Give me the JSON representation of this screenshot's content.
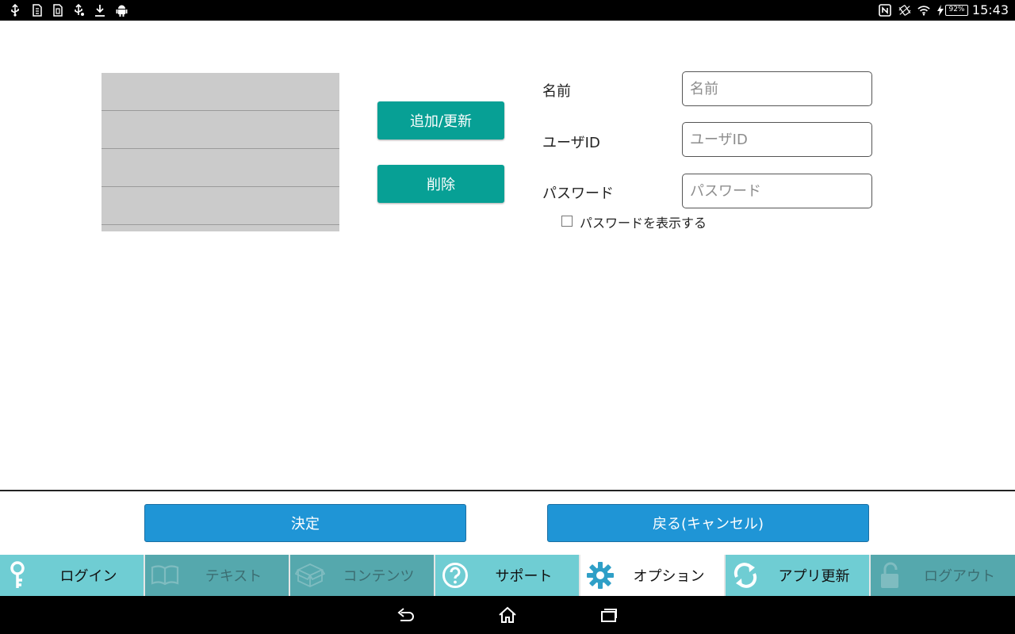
{
  "status_bar": {
    "time": "15:43",
    "battery": "92%",
    "left_icons": [
      "usb-icon",
      "sd-card-icon",
      "sd-card-icon",
      "usb-debug-icon",
      "download-icon",
      "android-icon"
    ],
    "right_icons": [
      "nfc-icon",
      "vibrate-icon",
      "wifi-icon",
      "charging-icon",
      "battery-icon"
    ]
  },
  "list": {
    "rows": 4
  },
  "buttons": {
    "add_update": "追加/更新",
    "delete": "削除",
    "ok": "決定",
    "back_cancel": "戻る(キャンセル)"
  },
  "form": {
    "name_label": "名前",
    "name_placeholder": "名前",
    "userid_label": "ユーザID",
    "userid_placeholder": "ユーザID",
    "password_label": "パスワード",
    "password_placeholder": "パスワード",
    "show_password": "パスワードを表示する",
    "show_password_checked": false
  },
  "tabs": [
    {
      "label": "ログイン",
      "icon": "key-icon",
      "state": "enabled"
    },
    {
      "label": "テキスト",
      "icon": "book-icon",
      "state": "disabled"
    },
    {
      "label": "コンテンツ",
      "icon": "box-icon",
      "state": "disabled"
    },
    {
      "label": "サポート",
      "icon": "help-icon",
      "state": "enabled"
    },
    {
      "label": "オプション",
      "icon": "gear-icon",
      "state": "selected"
    },
    {
      "label": "アプリ更新",
      "icon": "refresh-icon",
      "state": "enabled"
    },
    {
      "label": "ログアウト",
      "icon": "unlock-icon",
      "state": "disabled"
    }
  ],
  "nav_bar": [
    "back-icon",
    "home-icon",
    "recents-icon"
  ],
  "colors": {
    "teal_button": "#07a095",
    "blue_button": "#1f95d6",
    "tab_enabled": "#6fcdd3",
    "tab_disabled": "#55a8ad",
    "list_bg": "#cbcbcb"
  }
}
